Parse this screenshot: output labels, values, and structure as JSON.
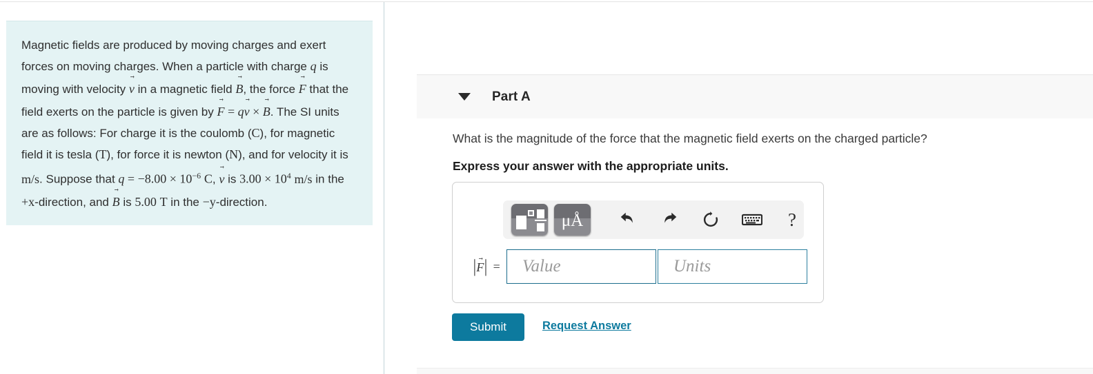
{
  "intro": {
    "segments": [
      {
        "t": "text",
        "v": "Magnetic fields are produced by moving charges and exert forces on moving charges. When a particle with charge "
      },
      {
        "t": "mi",
        "v": "q"
      },
      {
        "t": "text",
        "v": " is moving with velocity "
      },
      {
        "t": "vec",
        "v": "v"
      },
      {
        "t": "text",
        "v": " in a magnetic field "
      },
      {
        "t": "vec",
        "v": "B"
      },
      {
        "t": "text",
        "v": ", the force "
      },
      {
        "t": "vec",
        "v": "F"
      },
      {
        "t": "text",
        "v": " that the field exerts on the particle is given by "
      },
      {
        "t": "formula",
        "v": "F = qv × B"
      },
      {
        "t": "text",
        "v": ". The SI units are as follows: For charge it is the coulomb (C), for magnetic field it is tesla (T), for force it is newton (N), and for velocity it is m/s. Suppose that q = −8.00 × 10⁻⁶ C, v is 3.00 × 10⁴ m/s in the +x-direction, and B is 5.00 T in the −y-direction."
      }
    ],
    "plain_text": "Magnetic fields are produced by moving charges and exert forces on moving charges. When a particle with charge q is moving with velocity v in a magnetic field B, the force F that the field exerts on the particle is given by F = qv × B. The SI units are as follows: For charge it is the coulomb (C), for magnetic field it is tesla (T), for force it is newton (N), and for velocity it is m/s. Suppose that q = −8.00 × 10⁻⁶ C, v is 3.00 × 10⁴ m/s in the +x-direction, and B is 5.00 T in the −y-direction.",
    "line1": "Magnetic fields are produced by moving charges and",
    "line2": "exert forces on moving charges. When a particle with",
    "var_charge": "q",
    "var_velocity": "v",
    "var_field": "B",
    "var_force": "F",
    "lorentz_lhs": "F",
    "lorentz_rhs_q": "q",
    "lorentz_rhs_v": "v",
    "lorentz_cross": "×",
    "lorentz_rhs_B": "B",
    "unit_charge": "C",
    "unit_field": "T",
    "unit_force": "N",
    "unit_velocity_num": "m",
    "unit_velocity_den": "s",
    "q_value": "−8.00 × 10",
    "q_exp": "−6",
    "v_value": "3.00 × 10",
    "v_exp": "4",
    "B_value": "5.00",
    "v_direction": "+x",
    "B_direction": "−y",
    "background_color": "#e4f3f4"
  },
  "part": {
    "caret_icon": "caret-down-icon",
    "title": "Part A",
    "header_background": "#f8f8f8"
  },
  "question": {
    "prompt": "What is the magnitude of the force that the magnetic field exerts on the charged particle?",
    "instruction": "Express your answer with the appropriate units."
  },
  "answer": {
    "toolbar": {
      "buttons": [
        {
          "name": "math-template-button",
          "label": ""
        },
        {
          "name": "units-button",
          "label": "μÅ"
        },
        {
          "name": "undo-button",
          "label": "undo-icon"
        },
        {
          "name": "redo-button",
          "label": "redo-icon"
        },
        {
          "name": "reset-button",
          "label": "reset-icon"
        },
        {
          "name": "keyboard-button",
          "label": "keyboard-icon"
        },
        {
          "name": "help-button",
          "label": "?"
        }
      ],
      "units_label": "μÅ",
      "help_label": "?",
      "background": "#f2f2f2"
    },
    "label_variable": "F",
    "label_equals": "=",
    "label_bar": "|",
    "value_placeholder": "Value",
    "value_current": "",
    "units_placeholder": "Units",
    "units_current": "",
    "field_border_color": "#1a6c8c"
  },
  "actions": {
    "submit_label": "Submit",
    "request_answer_label": "Request Answer",
    "accent_color": "#0d7a9e"
  }
}
